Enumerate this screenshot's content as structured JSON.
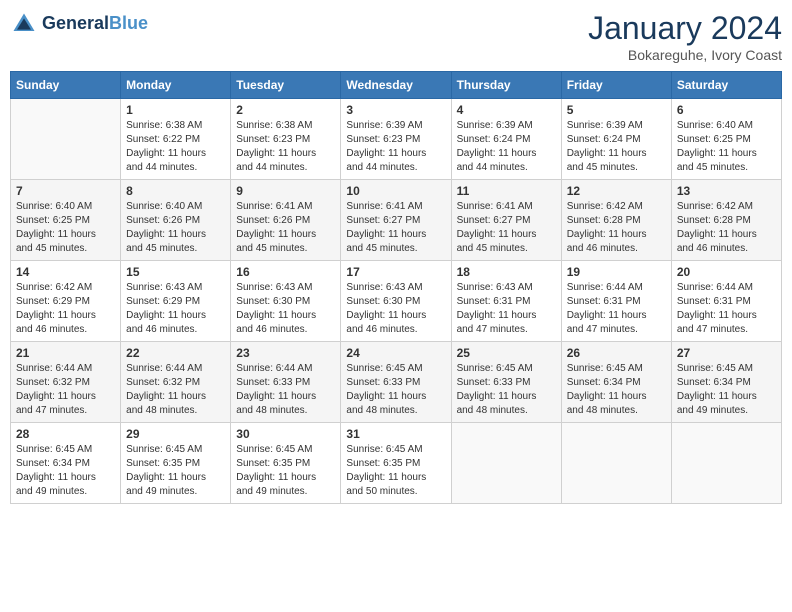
{
  "header": {
    "logo_line1": "General",
    "logo_line2": "Blue",
    "month_title": "January 2024",
    "location": "Bokareguhe, Ivory Coast"
  },
  "weekdays": [
    "Sunday",
    "Monday",
    "Tuesday",
    "Wednesday",
    "Thursday",
    "Friday",
    "Saturday"
  ],
  "weeks": [
    [
      {
        "day": "",
        "sunrise": "",
        "sunset": "",
        "daylight": ""
      },
      {
        "day": "1",
        "sunrise": "Sunrise: 6:38 AM",
        "sunset": "Sunset: 6:22 PM",
        "daylight": "Daylight: 11 hours and 44 minutes."
      },
      {
        "day": "2",
        "sunrise": "Sunrise: 6:38 AM",
        "sunset": "Sunset: 6:23 PM",
        "daylight": "Daylight: 11 hours and 44 minutes."
      },
      {
        "day": "3",
        "sunrise": "Sunrise: 6:39 AM",
        "sunset": "Sunset: 6:23 PM",
        "daylight": "Daylight: 11 hours and 44 minutes."
      },
      {
        "day": "4",
        "sunrise": "Sunrise: 6:39 AM",
        "sunset": "Sunset: 6:24 PM",
        "daylight": "Daylight: 11 hours and 44 minutes."
      },
      {
        "day": "5",
        "sunrise": "Sunrise: 6:39 AM",
        "sunset": "Sunset: 6:24 PM",
        "daylight": "Daylight: 11 hours and 45 minutes."
      },
      {
        "day": "6",
        "sunrise": "Sunrise: 6:40 AM",
        "sunset": "Sunset: 6:25 PM",
        "daylight": "Daylight: 11 hours and 45 minutes."
      }
    ],
    [
      {
        "day": "7",
        "sunrise": "Sunrise: 6:40 AM",
        "sunset": "Sunset: 6:25 PM",
        "daylight": "Daylight: 11 hours and 45 minutes."
      },
      {
        "day": "8",
        "sunrise": "Sunrise: 6:40 AM",
        "sunset": "Sunset: 6:26 PM",
        "daylight": "Daylight: 11 hours and 45 minutes."
      },
      {
        "day": "9",
        "sunrise": "Sunrise: 6:41 AM",
        "sunset": "Sunset: 6:26 PM",
        "daylight": "Daylight: 11 hours and 45 minutes."
      },
      {
        "day": "10",
        "sunrise": "Sunrise: 6:41 AM",
        "sunset": "Sunset: 6:27 PM",
        "daylight": "Daylight: 11 hours and 45 minutes."
      },
      {
        "day": "11",
        "sunrise": "Sunrise: 6:41 AM",
        "sunset": "Sunset: 6:27 PM",
        "daylight": "Daylight: 11 hours and 45 minutes."
      },
      {
        "day": "12",
        "sunrise": "Sunrise: 6:42 AM",
        "sunset": "Sunset: 6:28 PM",
        "daylight": "Daylight: 11 hours and 46 minutes."
      },
      {
        "day": "13",
        "sunrise": "Sunrise: 6:42 AM",
        "sunset": "Sunset: 6:28 PM",
        "daylight": "Daylight: 11 hours and 46 minutes."
      }
    ],
    [
      {
        "day": "14",
        "sunrise": "Sunrise: 6:42 AM",
        "sunset": "Sunset: 6:29 PM",
        "daylight": "Daylight: 11 hours and 46 minutes."
      },
      {
        "day": "15",
        "sunrise": "Sunrise: 6:43 AM",
        "sunset": "Sunset: 6:29 PM",
        "daylight": "Daylight: 11 hours and 46 minutes."
      },
      {
        "day": "16",
        "sunrise": "Sunrise: 6:43 AM",
        "sunset": "Sunset: 6:30 PM",
        "daylight": "Daylight: 11 hours and 46 minutes."
      },
      {
        "day": "17",
        "sunrise": "Sunrise: 6:43 AM",
        "sunset": "Sunset: 6:30 PM",
        "daylight": "Daylight: 11 hours and 46 minutes."
      },
      {
        "day": "18",
        "sunrise": "Sunrise: 6:43 AM",
        "sunset": "Sunset: 6:31 PM",
        "daylight": "Daylight: 11 hours and 47 minutes."
      },
      {
        "day": "19",
        "sunrise": "Sunrise: 6:44 AM",
        "sunset": "Sunset: 6:31 PM",
        "daylight": "Daylight: 11 hours and 47 minutes."
      },
      {
        "day": "20",
        "sunrise": "Sunrise: 6:44 AM",
        "sunset": "Sunset: 6:31 PM",
        "daylight": "Daylight: 11 hours and 47 minutes."
      }
    ],
    [
      {
        "day": "21",
        "sunrise": "Sunrise: 6:44 AM",
        "sunset": "Sunset: 6:32 PM",
        "daylight": "Daylight: 11 hours and 47 minutes."
      },
      {
        "day": "22",
        "sunrise": "Sunrise: 6:44 AM",
        "sunset": "Sunset: 6:32 PM",
        "daylight": "Daylight: 11 hours and 48 minutes."
      },
      {
        "day": "23",
        "sunrise": "Sunrise: 6:44 AM",
        "sunset": "Sunset: 6:33 PM",
        "daylight": "Daylight: 11 hours and 48 minutes."
      },
      {
        "day": "24",
        "sunrise": "Sunrise: 6:45 AM",
        "sunset": "Sunset: 6:33 PM",
        "daylight": "Daylight: 11 hours and 48 minutes."
      },
      {
        "day": "25",
        "sunrise": "Sunrise: 6:45 AM",
        "sunset": "Sunset: 6:33 PM",
        "daylight": "Daylight: 11 hours and 48 minutes."
      },
      {
        "day": "26",
        "sunrise": "Sunrise: 6:45 AM",
        "sunset": "Sunset: 6:34 PM",
        "daylight": "Daylight: 11 hours and 48 minutes."
      },
      {
        "day": "27",
        "sunrise": "Sunrise: 6:45 AM",
        "sunset": "Sunset: 6:34 PM",
        "daylight": "Daylight: 11 hours and 49 minutes."
      }
    ],
    [
      {
        "day": "28",
        "sunrise": "Sunrise: 6:45 AM",
        "sunset": "Sunset: 6:34 PM",
        "daylight": "Daylight: 11 hours and 49 minutes."
      },
      {
        "day": "29",
        "sunrise": "Sunrise: 6:45 AM",
        "sunset": "Sunset: 6:35 PM",
        "daylight": "Daylight: 11 hours and 49 minutes."
      },
      {
        "day": "30",
        "sunrise": "Sunrise: 6:45 AM",
        "sunset": "Sunset: 6:35 PM",
        "daylight": "Daylight: 11 hours and 49 minutes."
      },
      {
        "day": "31",
        "sunrise": "Sunrise: 6:45 AM",
        "sunset": "Sunset: 6:35 PM",
        "daylight": "Daylight: 11 hours and 50 minutes."
      },
      {
        "day": "",
        "sunrise": "",
        "sunset": "",
        "daylight": ""
      },
      {
        "day": "",
        "sunrise": "",
        "sunset": "",
        "daylight": ""
      },
      {
        "day": "",
        "sunrise": "",
        "sunset": "",
        "daylight": ""
      }
    ]
  ]
}
